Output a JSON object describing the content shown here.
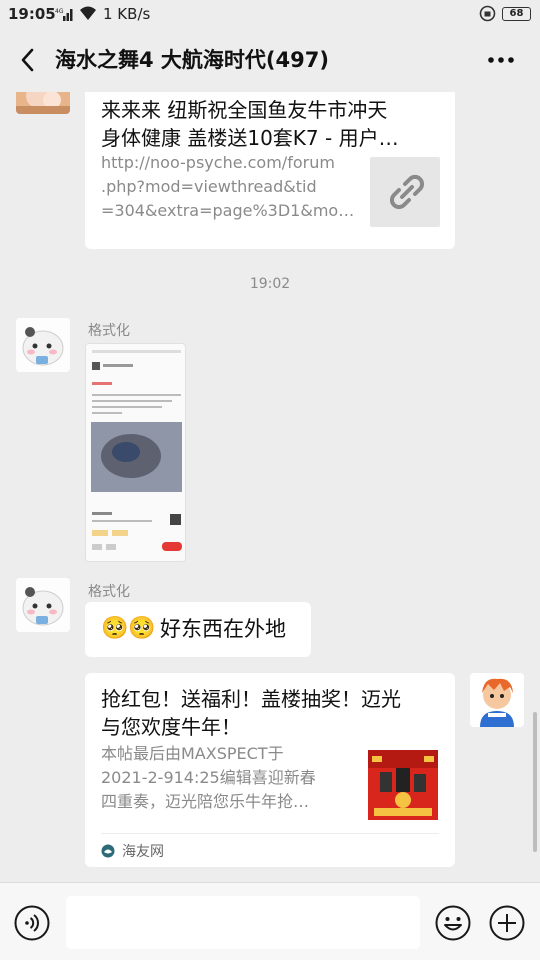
{
  "status_bar": {
    "time": "19:05",
    "network": "4G",
    "speed": "1 KB/s",
    "battery": "68"
  },
  "header": {
    "title": "海水之舞4 大航海时代(497)",
    "back_icon": "chevron-left-icon",
    "more_icon": "more-dots-icon"
  },
  "messages": [
    {
      "type": "link",
      "title_line1": "来来来 纽斯祝全国鱼友牛市冲天",
      "title_line2": "身体健康 盖楼送10套K7 - 用户…",
      "url_line1": "http://noo-psyche.com/forum",
      "url_line2": ".php?mod=viewthread&tid",
      "url_line3": "=304&extra=page%3D1&mo…",
      "thumb_icon": "link-icon"
    },
    {
      "type": "time",
      "text": "19:02"
    },
    {
      "type": "image",
      "sender": "格式化"
    },
    {
      "type": "text",
      "sender": "格式化",
      "emoji": "🥺🥺",
      "text": "好东西在外地"
    },
    {
      "type": "link-outgoing",
      "title_line1": "抢红包！送福利！盖楼抽奖！迈光",
      "title_line2": "与您欢度牛年！",
      "desc_line1": "本帖最后由MAXSPECT于",
      "desc_line2": "2021-2-914:25编辑喜迎新春",
      "desc_line3": "四重奏，迈光陪您乐牛年抢…",
      "source": "海友网"
    }
  ],
  "input_bar": {
    "voice_icon": "voice-icon",
    "emoji_icon": "emoji-icon",
    "plus_icon": "plus-circle-icon"
  },
  "colors": {
    "background": "#ededed",
    "bubble": "#ffffff",
    "muted_text": "#8a8a8a",
    "red_envelope": "#d9261c"
  }
}
